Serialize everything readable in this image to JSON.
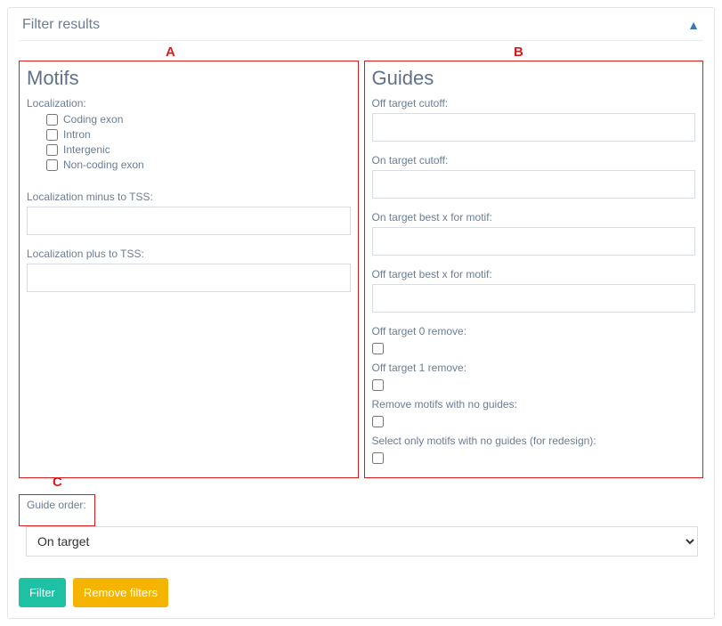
{
  "panel": {
    "title": "Filter results"
  },
  "annots": {
    "a": "A",
    "b": "B",
    "c": "C"
  },
  "motifs": {
    "title": "Motifs",
    "loc_label": "Localization:",
    "options": {
      "coding": "Coding exon",
      "intron": "Intron",
      "intergenic": "Intergenic",
      "noncoding": "Non-coding exon"
    },
    "minus_tss": "Localization minus to TSS:",
    "plus_tss": "Localization plus to TSS:"
  },
  "guides": {
    "title": "Guides",
    "off_cutoff": "Off target cutoff:",
    "on_cutoff": "On target cutoff:",
    "on_best": "On target best x for motif:",
    "off_best": "Off target best x for motif:",
    "off0": "Off target 0 remove:",
    "off1": "Off target 1 remove:",
    "remove_no_guides": "Remove motifs with no guides:",
    "select_no_guides": "Select only motifs with no guides (for redesign):"
  },
  "order": {
    "label": "Guide order:",
    "selected": "On target"
  },
  "buttons": {
    "filter": "Filter",
    "remove": "Remove filters"
  }
}
